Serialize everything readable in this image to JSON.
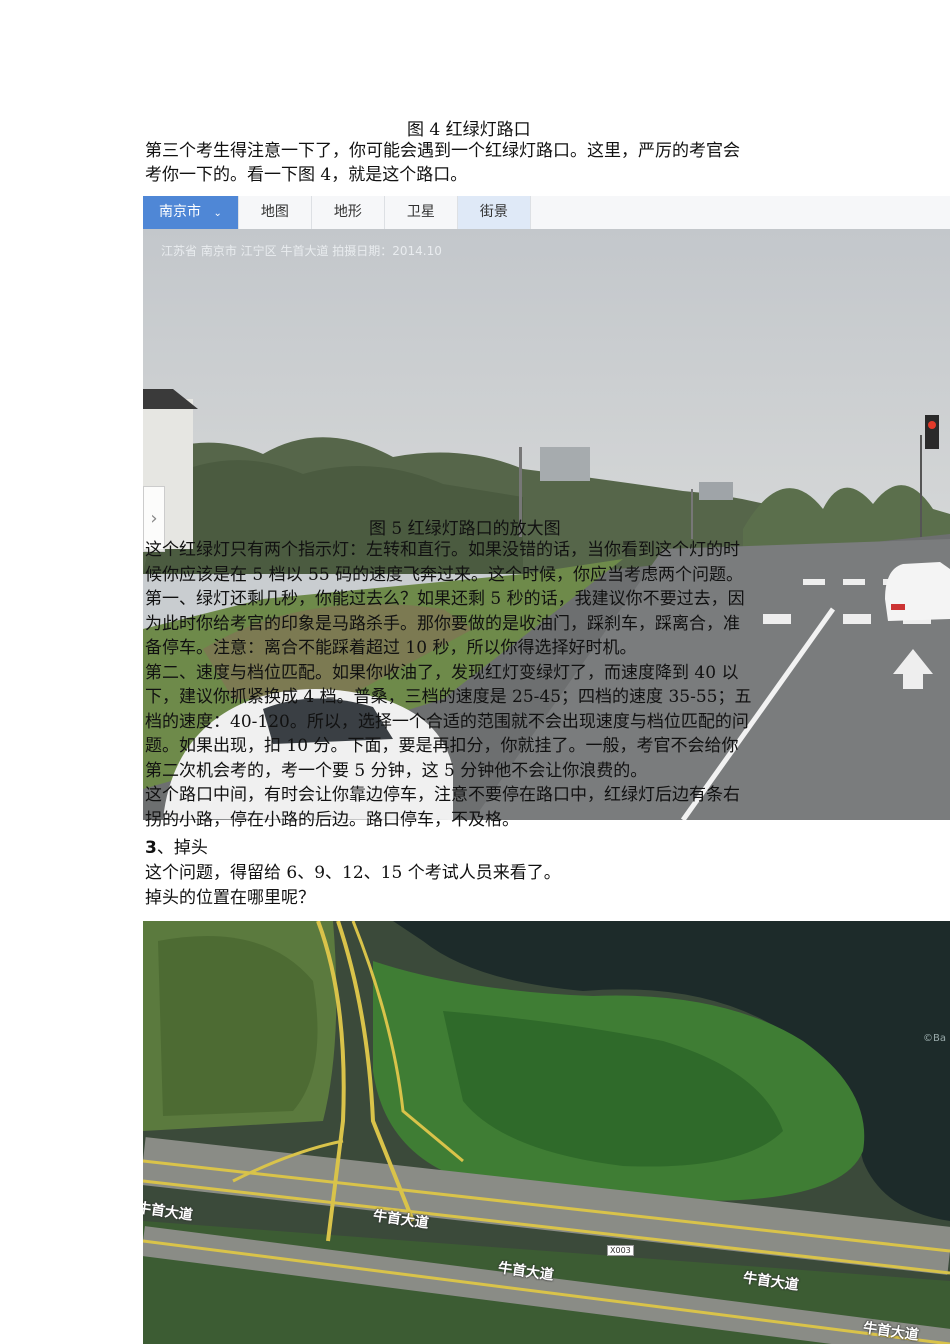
{
  "fig4": {
    "caption": "图 4  红绿灯路口"
  },
  "intro": {
    "line1": "第三个考生得注意一下了，你可能会遇到一个红绿灯路口。这里，严厉的考官会",
    "line2": "考你一下的。看一下图 4，就是这个路口。"
  },
  "map_ui": {
    "city": "南京市",
    "tabs": [
      "地图",
      "地形",
      "卫星",
      "街景"
    ],
    "active_tab": "街景",
    "street_meta": "江苏省 南京市 江宁区 牛首大道  拍摄日期：2014.10",
    "prev_arrow": "›"
  },
  "fig5": {
    "caption": "图 5  红绿灯路口的放大图"
  },
  "overlay_lines": [
    "这个红绿灯只有两个指示灯：左转和直行。如果没错的话，当你看到这个灯的时",
    "候你应该是在 5 档以 55 码的速度飞奔过来。这个时候，你应当考虑两个问题。",
    "第一、绿灯还剩几秒，你能过去么？如果还剩 5 秒的话，我建议你不要过去，因",
    "为此时你给考官的印象是马路杀手。那你要做的是收油门，踩刹车，踩离合，准",
    "备停车。注意：离合不能踩着超过 10 秒，所以你得选择好时机。",
    "第二、速度与档位匹配。如果你收油了，发现红灯变绿灯了，而速度降到 40 以",
    "下，建议你抓紧换成 4 档。普桑，三档的速度是 25-45；四档的速度 35-55；五",
    "档的速度：40-120。所以，选择一个合适的范围就不会出现速度与档位匹配的问",
    "题。如果出现，扣 10 分。下面，要是再扣分，你就挂了。一般，考官不会给你",
    "第二次机会考的，考一个要 5 分钟，这 5 分钟他不会让你浪费的。",
    "这个路口中间，有时会让你靠边停车，注意不要停在路口中，红绿灯后边有条右",
    "拐的小路，停在小路的后边。路口停车，不及格。"
  ],
  "section3": {
    "heading_num": "3",
    "heading_text": "、掉头",
    "line1": "这个问题，得留给 6、9、12、15 个考试人员来看了。",
    "line2": "掉头的位置在哪里呢？"
  },
  "satellite": {
    "road_labels": [
      "牛首大道",
      "牛首大道",
      "牛首大道",
      "牛首大道",
      "牛首大道"
    ],
    "route_badge": "X003",
    "watermark": "©Ba"
  }
}
